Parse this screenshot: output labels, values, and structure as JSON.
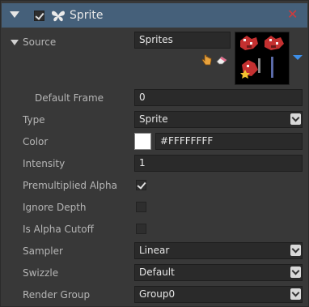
{
  "header": {
    "title": "Sprite",
    "enabled": true,
    "accent_color": "#45607a",
    "icon": "butterfly-icon"
  },
  "source": {
    "label": "Source",
    "value": "Sprites"
  },
  "rows": {
    "default_frame": {
      "label": "Default Frame",
      "value": "0"
    },
    "type": {
      "label": "Type",
      "value": "Sprite"
    },
    "color": {
      "label": "Color",
      "value": "#FFFFFFFF",
      "swatch": "#ffffff"
    },
    "intensity": {
      "label": "Intensity",
      "value": "1"
    },
    "premultiplied_alpha": {
      "label": "Premultiplied Alpha",
      "checked": true
    },
    "ignore_depth": {
      "label": "Ignore Depth",
      "checked": false
    },
    "is_alpha_cutoff": {
      "label": "Is Alpha Cutoff",
      "checked": false
    },
    "sampler": {
      "label": "Sampler",
      "value": "Linear"
    },
    "swizzle": {
      "label": "Swizzle",
      "value": "Default"
    },
    "render_group": {
      "label": "Render Group",
      "value": "Group0"
    }
  }
}
